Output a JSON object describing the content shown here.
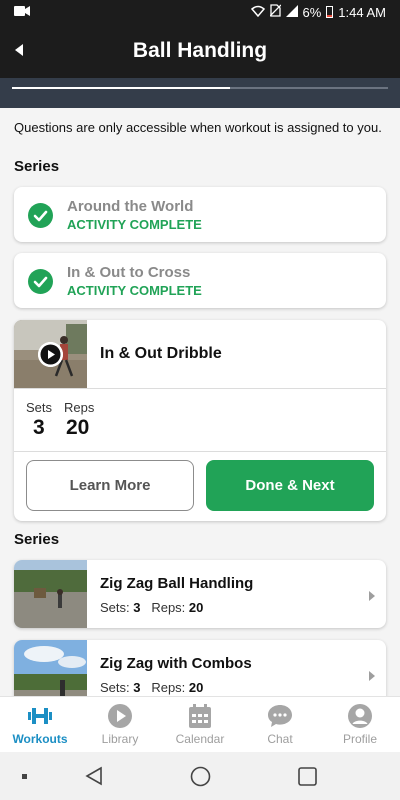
{
  "status_bar": {
    "battery": "6%",
    "time": "1:44 AM"
  },
  "header": {
    "title": "Ball Handling",
    "progress": 0.58
  },
  "notice": "Questions are only accessible when workout is assigned to you.",
  "sections": {
    "first": "Series",
    "second": "Series"
  },
  "completed": [
    {
      "title": "Around the World",
      "status": "ACTIVITY COMPLETE"
    },
    {
      "title": "In & Out to Cross",
      "status": "ACTIVITY COMPLETE"
    }
  ],
  "active": {
    "title": "In & Out Dribble",
    "sets_label": "Sets",
    "sets": "3",
    "reps_label": "Reps",
    "reps": "20",
    "learn_more": "Learn More",
    "done_next": "Done & Next"
  },
  "series": [
    {
      "title": "Zig Zag Ball Handling",
      "sets_label": "Sets:",
      "sets": "3",
      "reps_label": "Reps:",
      "reps": "20"
    },
    {
      "title": "Zig Zag with Combos",
      "sets_label": "Sets:",
      "sets": "3",
      "reps_label": "Reps:",
      "reps": "20"
    }
  ],
  "tabs": [
    {
      "label": "Workouts",
      "icon": "dumbbell-icon",
      "active": true
    },
    {
      "label": "Library",
      "icon": "play-circle-icon",
      "active": false
    },
    {
      "label": "Calendar",
      "icon": "calendar-icon",
      "active": false
    },
    {
      "label": "Chat",
      "icon": "chat-bubble-icon",
      "active": false
    },
    {
      "label": "Profile",
      "icon": "profile-icon",
      "active": false
    }
  ],
  "colors": {
    "accent_green": "#21a357",
    "tab_active": "#1c8fc4",
    "header_bg": "#1c1c1c"
  }
}
